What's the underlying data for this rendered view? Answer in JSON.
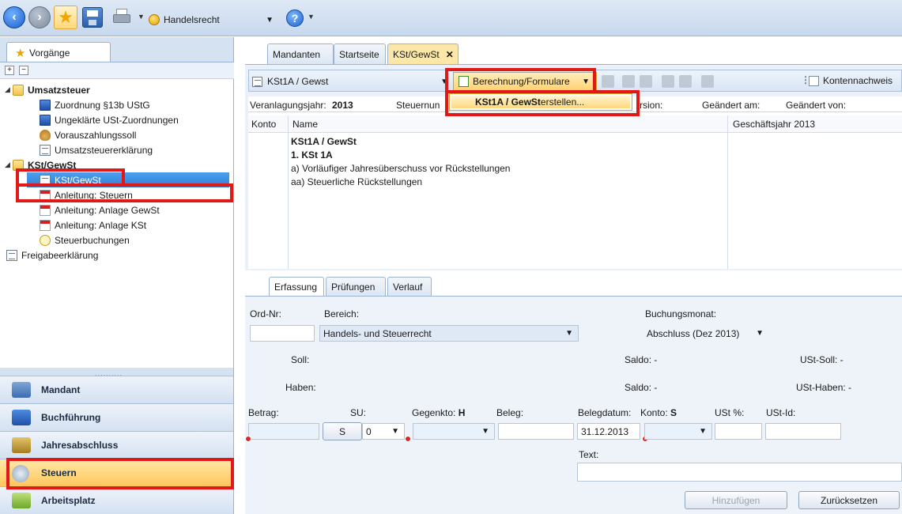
{
  "toolbar": {
    "profile_label": "Handelsrecht",
    "help_label": "?"
  },
  "left": {
    "tab_label": "Vorgänge",
    "expand_all": "+",
    "collapse_all": "−",
    "tree": [
      {
        "label": "Umsatzsteuer"
      },
      {
        "label": "Zuordnung §13b UStG"
      },
      {
        "label": "Ungeklärte USt-Zuordnungen"
      },
      {
        "label": "Vorauszahlungssoll"
      },
      {
        "label": "Umsatzsteuererklärung"
      },
      {
        "label": "KSt/GewSt"
      },
      {
        "label": "KSt/GewSt"
      },
      {
        "label": "Anleitung: Steuern"
      },
      {
        "label": "Anleitung: Anlage GewSt"
      },
      {
        "label": "Anleitung: Anlage KSt"
      },
      {
        "label": "Steuerbuchungen"
      },
      {
        "label": "Freigabeerklärung"
      }
    ],
    "grip": "..........",
    "nav": [
      {
        "label": "Mandant"
      },
      {
        "label": "Buchführung"
      },
      {
        "label": "Jahresabschluss"
      },
      {
        "label": "Steuern"
      },
      {
        "label": "Arbeitsplatz"
      }
    ]
  },
  "tabs": [
    {
      "label": "Mandanten"
    },
    {
      "label": "Startseite"
    },
    {
      "label": "KSt/GewSt"
    }
  ],
  "tab_close": "✕",
  "form_toolbar": {
    "doc_select": "KSt1A / Gewst",
    "calc_menu": "Berechnung/Formulare",
    "konto_check": "Kontennachweis"
  },
  "dropdown": {
    "item_bold": "KSt1A / GewSt",
    "item_rest": " erstellen..."
  },
  "infoline": {
    "year_label": "Veranlagungsjahr:",
    "year_value": "2013",
    "tax_label": "Steuernun",
    "version_label": "rsion:",
    "changed_at": "Geändert am:",
    "changed_by": "Geändert von:"
  },
  "grid": {
    "col_konto": "Konto",
    "col_name": "Name",
    "col_year": "Geschäftsjahr 2013",
    "lines": [
      "KSt1A / GewSt",
      "1. KSt 1A",
      "a) Vorläufiger Jahresüberschuss vor Rückstellungen",
      "aa) Steuerliche Rückstellungen"
    ]
  },
  "lower_tabs": [
    {
      "label": "Erfassung"
    },
    {
      "label": "Prüfungen"
    },
    {
      "label": "Verlauf"
    }
  ],
  "entry": {
    "ord_nr": "Ord-Nr:",
    "bereich_label": "Bereich:",
    "bereich_value": "Handels- und Steuerrecht",
    "buchungsmonat_label": "Buchungsmonat:",
    "buchungsmonat_value": "Abschluss (Dez 2013)",
    "soll": "Soll:",
    "haben": "Haben:",
    "saldo1": "Saldo: -",
    "saldo2": "Saldo: -",
    "ust_soll": "USt-Soll: -",
    "ust_haben": "USt-Haben: -",
    "betrag": "Betrag:",
    "su": "SU:",
    "gegenkto": "Gegenkto:",
    "gegenkto_flag": "H",
    "beleg": "Beleg:",
    "belegdatum": "Belegdatum:",
    "konto": "Konto:",
    "konto_flag": "S",
    "ust_pct": "USt %:",
    "ust_id": "USt-Id:",
    "s_button": "S",
    "su_value": "0",
    "date_value": "31.12.2013",
    "text_label": "Text:",
    "add_button": "Hinzufügen",
    "reset_button": "Zurücksetzen"
  }
}
